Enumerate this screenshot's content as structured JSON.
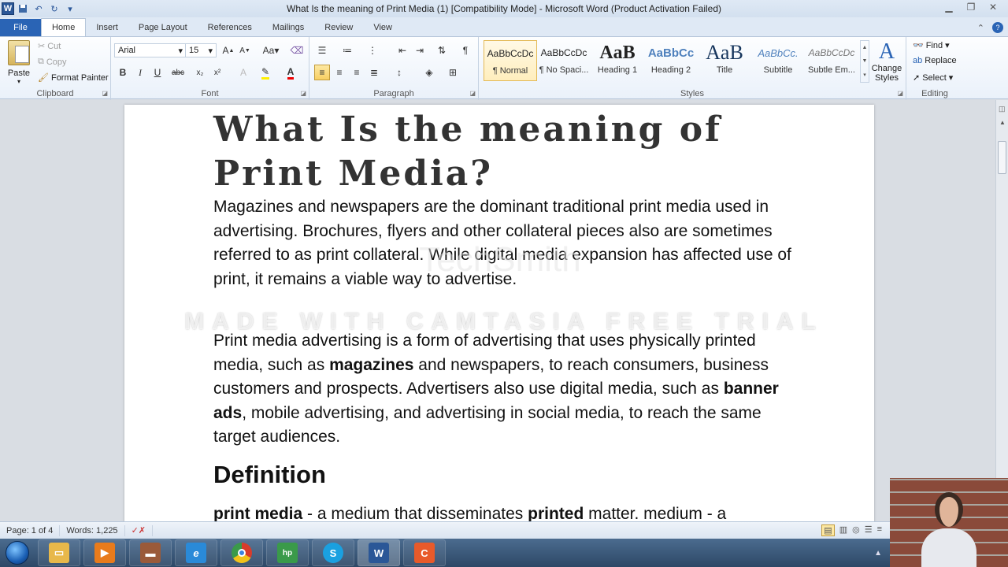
{
  "window": {
    "title": "What Is the meaning of Print Media (1) [Compatibility Mode]  -  Microsoft Word (Product Activation Failed)",
    "app_icon": "W",
    "qat": [
      "save-icon",
      "undo-icon",
      "redo-icon",
      "customize-icon"
    ]
  },
  "tabs": {
    "file": "File",
    "items": [
      "Home",
      "Insert",
      "Page Layout",
      "References",
      "Mailings",
      "Review",
      "View"
    ],
    "active": "Home"
  },
  "ribbon": {
    "clipboard": {
      "label": "Clipboard",
      "paste": "Paste",
      "cut": "Cut",
      "copy": "Copy",
      "format_painter": "Format Painter"
    },
    "font": {
      "label": "Font",
      "family": "Arial",
      "size": "15",
      "change_case": "Aa",
      "bold": "B",
      "italic": "I",
      "underline": "U",
      "strike": "abc",
      "subscript": "x₂",
      "superscript": "x²"
    },
    "paragraph": {
      "label": "Paragraph"
    },
    "styles": {
      "label": "Styles",
      "items": [
        {
          "sample": "AaBbCcDc",
          "name": "¶ Normal"
        },
        {
          "sample": "AaBbCcDc",
          "name": "¶ No Spaci..."
        },
        {
          "sample": "AaB",
          "name": "Heading 1"
        },
        {
          "sample": "AaBbCc",
          "name": "Heading 2"
        },
        {
          "sample": "AaB",
          "name": "Title"
        },
        {
          "sample": "AaBbCc.",
          "name": "Subtitle"
        },
        {
          "sample": "AaBbCcDc",
          "name": "Subtle Em..."
        }
      ],
      "change_styles": "Change Styles"
    },
    "editing": {
      "label": "Editing",
      "find": "Find",
      "replace": "Replace",
      "select": "Select"
    }
  },
  "document": {
    "title": "What Is the meaning of Print Media?",
    "para1": "Magazines and newspapers are the dominant traditional print media used in advertising. Brochures, flyers and other collateral pieces also are sometimes referred to as print collateral. While digital media expansion has affected use of print, it remains a viable way to advertise.",
    "para2_parts": [
      "Print media advertising is a form of advertising that uses physically printed media, such as ",
      "magazines",
      " and newspapers, to reach consumers, business customers and prospects. Advertisers also use digital media, such as ",
      "banner ads",
      ", mobile advertising, and advertising in social media, to reach the same target audiences."
    ],
    "definition_heading": "Definition",
    "definition_parts": [
      "print media",
      " - a medium that disseminates ",
      "printed",
      " matter. medium - a"
    ],
    "watermark": "MADE WITH CAMTASIA FREE TRIAL",
    "watermark_logo": "TechSmith"
  },
  "status": {
    "page": "Page: 1 of 4",
    "words": "Words: 1,225"
  },
  "taskbar": {
    "apps": [
      {
        "name": "file-explorer",
        "color": "#e8b84a"
      },
      {
        "name": "media-player",
        "color": "#e87b1c"
      },
      {
        "name": "generic-app",
        "color": "#9a5a3a"
      },
      {
        "name": "internet-explorer",
        "color": "#2a8ad8"
      },
      {
        "name": "chrome",
        "color": "#d93b2b"
      },
      {
        "name": "hp-app",
        "color": "#3a9a4a"
      },
      {
        "name": "skype",
        "color": "#1aa0e0"
      },
      {
        "name": "word",
        "color": "#2b5797"
      },
      {
        "name": "camtasia",
        "color": "#e85a2a"
      }
    ]
  }
}
